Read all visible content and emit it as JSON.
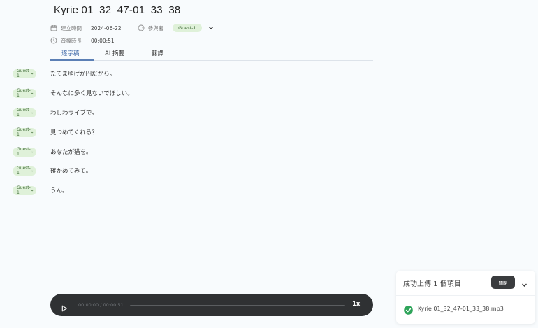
{
  "header": {
    "title": "Kyrie 01_32_47-01_33_38",
    "created_label": "建立時間",
    "created_value": "2024-06-22",
    "participants_label": "參與者",
    "participant": "Guest-1",
    "duration_label": "音檔時長",
    "duration_value": "00:00:51"
  },
  "tabs": [
    {
      "label": "逐字稿",
      "active": true
    },
    {
      "label": "AI 摘要",
      "active": false
    },
    {
      "label": "翻譯",
      "active": false
    }
  ],
  "transcript": [
    {
      "speaker": "Guest-1",
      "text": "たてまゆげが円だから。"
    },
    {
      "speaker": "Guest-1",
      "text": "そんなに多く見ないでほしい。"
    },
    {
      "speaker": "Guest-1",
      "text": "わしわライブで。"
    },
    {
      "speaker": "Guest-1",
      "text": "見つめてくれる？"
    },
    {
      "speaker": "Guest-1",
      "text": "あなたが猫を。"
    },
    {
      "speaker": "Guest-1",
      "text": "確かめてみて。"
    },
    {
      "speaker": "Guest-1",
      "text": "うん。"
    }
  ],
  "player": {
    "time": "00:00:00 / 00:00:51",
    "speed": "1x",
    "progress": 0
  },
  "upload_panel": {
    "title": "成功上傳 1 個項目",
    "close_label": "關閉",
    "file_name": "Kyrie 01_32_47-01_33_38.mp3"
  },
  "colors": {
    "accent": "#3d67a8",
    "speaker_bg": "#dff1d9",
    "speaker_fg": "#3f6b37",
    "player_bg": "#2f3133",
    "success": "#2fa45a"
  }
}
